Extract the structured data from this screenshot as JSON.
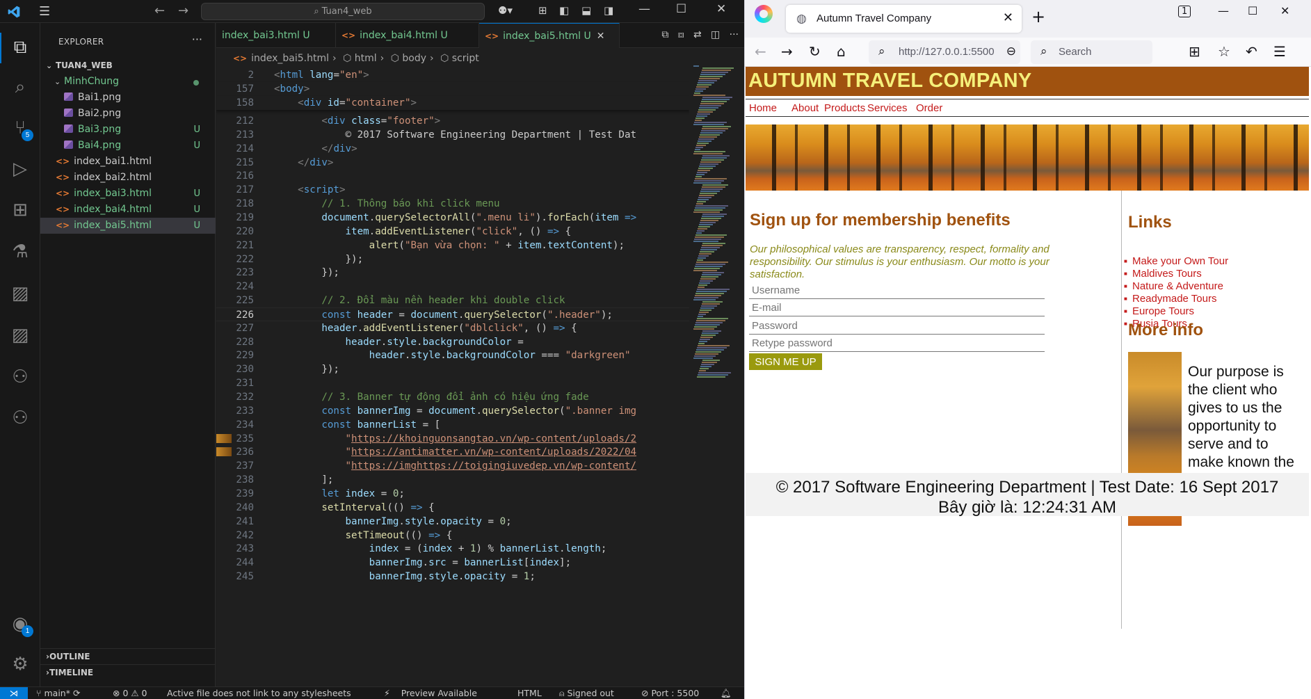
{
  "vscode": {
    "command_center": "Tuan4_web",
    "explorer": {
      "title": "EXPLORER",
      "root": "TUAN4_WEB",
      "folder": "MinhChung",
      "files": [
        {
          "name": "Bai1.png",
          "status": ""
        },
        {
          "name": "Bai2.png",
          "status": ""
        },
        {
          "name": "Bai3.png",
          "status": "U"
        },
        {
          "name": "Bai4.png",
          "status": "U"
        }
      ],
      "root_files": [
        {
          "name": "index_bai1.html",
          "status": ""
        },
        {
          "name": "index_bai2.html",
          "status": ""
        },
        {
          "name": "index_bai3.html",
          "status": "U"
        },
        {
          "name": "index_bai4.html",
          "status": "U"
        },
        {
          "name": "index_bai5.html",
          "status": "U"
        }
      ],
      "outline": "OUTLINE",
      "timeline": "TIMELINE"
    },
    "badges": {
      "source_control": "5",
      "accounts": "1"
    },
    "tabs": [
      {
        "label": "index_bai3.html",
        "status": "U"
      },
      {
        "label": "index_bai4.html",
        "status": "U"
      },
      {
        "label": "index_bai5.html",
        "status": "U"
      }
    ],
    "breadcrumb": [
      "index_bai5.html",
      "html",
      "body",
      "script"
    ],
    "status_bar": {
      "branch": "main*",
      "problems": "⊗ 0 ⚠ 0",
      "message": "Active file does not link to any stylesheets",
      "preview": "Preview Available",
      "language": "HTML",
      "signed": "Signed out",
      "port": "Port : 5500"
    },
    "code_lines": [
      {
        "n": "2",
        "html": "<span class='p'>&lt;</span><span class='t'>html</span> <span class='a'>lang</span>=<span class='s'>\"en\"</span><span class='p'>&gt;</span>"
      },
      {
        "n": "157",
        "html": "<span class='p'>&lt;</span><span class='t'>body</span><span class='p'>&gt;</span>"
      },
      {
        "n": "158",
        "html": "    <span class='p'>&lt;</span><span class='t'>div</span> <span class='a'>id</span>=<span class='s'>\"container\"</span><span class='p'>&gt;</span>"
      },
      {
        "n": "212",
        "html": "        <span class='p'>&lt;</span><span class='t'>div</span> <span class='a'>class</span>=<span class='s'>\"footer\"</span><span class='p'>&gt;</span>"
      },
      {
        "n": "213",
        "html": "            © 2017 Software Engineering Department | Test Dat"
      },
      {
        "n": "214",
        "html": "        <span class='p'>&lt;/</span><span class='t'>div</span><span class='p'>&gt;</span>"
      },
      {
        "n": "215",
        "html": "    <span class='p'>&lt;/</span><span class='t'>div</span><span class='p'>&gt;</span>"
      },
      {
        "n": "216",
        "html": ""
      },
      {
        "n": "217",
        "html": "    <span class='p'>&lt;</span><span class='t'>script</span><span class='p'>&gt;</span>"
      },
      {
        "n": "218",
        "html": "        <span class='c'>// 1. Thông báo khi click menu</span>"
      },
      {
        "n": "219",
        "html": "        <span class='v'>document</span>.<span class='f'>querySelectorAll</span>(<span class='s'>\".menu li\"</span>).<span class='f'>forEach</span>(<span class='v'>item</span> <span class='k'>=&gt;</span>"
      },
      {
        "n": "220",
        "html": "            <span class='v'>item</span>.<span class='f'>addEventListener</span>(<span class='s'>\"click\"</span>, () <span class='k'>=&gt;</span> {"
      },
      {
        "n": "221",
        "html": "                <span class='f'>alert</span>(<span class='s'>\"Bạn vừa chọn: \"</span> + <span class='v'>item</span>.<span class='v'>textContent</span>);"
      },
      {
        "n": "222",
        "html": "            });"
      },
      {
        "n": "223",
        "html": "        });"
      },
      {
        "n": "224",
        "html": ""
      },
      {
        "n": "225",
        "html": "        <span class='c'>// 2. Đổi màu nền header khi double click</span>"
      },
      {
        "n": "226",
        "html": "        <span class='k'>const</span> <span class='v'>header</span> = <span class='v'>document</span>.<span class='f'>querySelector</span>(<span class='s'>\".header\"</span>);"
      },
      {
        "n": "227",
        "html": "        <span class='v'>header</span>.<span class='f'>addEventListener</span>(<span class='s'>\"dblclick\"</span>, () <span class='k'>=&gt;</span> {"
      },
      {
        "n": "228",
        "html": "            <span class='v'>header</span>.<span class='v'>style</span>.<span class='v'>backgroundColor</span> ="
      },
      {
        "n": "229",
        "html": "                <span class='v'>header</span>.<span class='v'>style</span>.<span class='v'>backgroundColor</span> === <span class='s'>\"darkgreen\"</span>"
      },
      {
        "n": "230",
        "html": "        });"
      },
      {
        "n": "231",
        "html": ""
      },
      {
        "n": "232",
        "html": "        <span class='c'>// 3. Banner tự động đổi ảnh có hiệu ứng fade</span>"
      },
      {
        "n": "233",
        "html": "        <span class='k'>const</span> <span class='v'>bannerImg</span> = <span class='v'>document</span>.<span class='f'>querySelector</span>(<span class='s'>\".banner img</span>"
      },
      {
        "n": "234",
        "html": "        <span class='k'>const</span> <span class='v'>bannerList</span> = ["
      },
      {
        "n": "235",
        "html": "            <span class='s'>\"<span class='u'>https://khoinguonsangtao.vn/wp-content/uploads/2</span></span>"
      },
      {
        "n": "236",
        "html": "            <span class='s'>\"<span class='u'>https://antimatter.vn/wp-content/uploads/2022/04</span></span>"
      },
      {
        "n": "237",
        "html": "            <span class='s'>\"<span class='u'>https://imghttps://toigingiuvedep.vn/wp-content/</span></span>"
      },
      {
        "n": "238",
        "html": "        ];"
      },
      {
        "n": "239",
        "html": "        <span class='k'>let</span> <span class='v'>index</span> = <span class='n'>0</span>;"
      },
      {
        "n": "240",
        "html": "        <span class='f'>setInterval</span>(() <span class='k'>=&gt;</span> {"
      },
      {
        "n": "241",
        "html": "            <span class='v'>bannerImg</span>.<span class='v'>style</span>.<span class='v'>opacity</span> = <span class='n'>0</span>;"
      },
      {
        "n": "242",
        "html": "            <span class='f'>setTimeout</span>(() <span class='k'>=&gt;</span> {"
      },
      {
        "n": "243",
        "html": "                <span class='v'>index</span> = (<span class='v'>index</span> + <span class='n'>1</span>) % <span class='v'>bannerList</span>.<span class='v'>length</span>;"
      },
      {
        "n": "244",
        "html": "                <span class='v'>bannerImg</span>.<span class='v'>src</span> = <span class='v'>bannerList</span>[<span class='v'>index</span>];"
      },
      {
        "n": "245",
        "html": "                <span class='v'>bannerImg</span>.<span class='v'>style</span>.<span class='v'>opacity</span> = <span class='n'>1</span>;"
      }
    ]
  },
  "firefox": {
    "tab_title": "Autumn Travel Company",
    "url": "http://127.0.0.1:5500",
    "search_placeholder": "Search",
    "tab_count": "1",
    "page": {
      "header": "AUTUMN TRAVEL COMPANY",
      "menu": [
        "Home",
        "About",
        "Products",
        "Services",
        "Order"
      ],
      "signup_title": "Sign up for membership benefits",
      "intro": "Our philosophical values are transparency, respect, formality and responsibility. Our stimulus is your enthusiasm. Our motto is your satisfaction.",
      "placeholders": {
        "username": "Username",
        "email": "E-mail",
        "password": "Password",
        "retype": "Retype password"
      },
      "signup_button": "SIGN ME UP",
      "links_title": "Links",
      "links": [
        "Make your Own Tour",
        "Maldives Tours",
        "Nature & Adventure",
        "Readymade Tours",
        "Europe Tours",
        "Rusia Tours"
      ],
      "more_info_title": "More info",
      "purpose": "Our purpose is the client who gives to us the opportunity to serve and to make known the reality around the world.",
      "footer_line1": "© 2017 Software Engineering Department | Test Date: 16 Sept 2017",
      "footer_line2": "Bây giờ là: 12:24:31 AM"
    }
  }
}
